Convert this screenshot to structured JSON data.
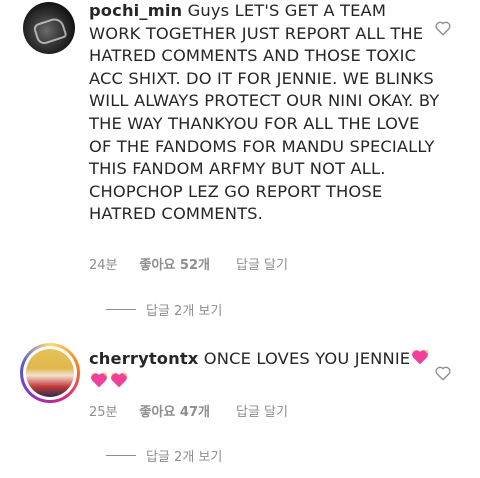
{
  "comments": [
    {
      "username": "pochi_min",
      "text": "Guys LET'S GET A TEAM WORK TOGETHER JUST REPORT ALL THE HATRED COMMENTS AND THOSE TOXIC ACC SHIXT. DO IT FOR JENNIE. WE BLINKS WILL ALWAYS PROTECT OUR NINI OKAY. BY THE WAY THANKYOU FOR ALL THE LOVE OF THE FANDOMS FOR MANDU SPECIALLY THIS FANDOM ARFMY BUT NOT ALL. CHOPCHOP LEZ GO REPORT THOSE HATRED COMMENTS.",
      "time": "24분",
      "likes": "좋아요 52개",
      "reply": "답글 달기",
      "view_replies": "답글 2개 보기",
      "heart_icon": "heart-outline-icon"
    },
    {
      "username": "cherrytontx",
      "text": "ONCE LOVES YOU JENNIE",
      "emoji": "💖💖💖",
      "emoji_icon": "sparkling-heart-emoji-icon",
      "time": "25분",
      "likes": "좋아요 47개",
      "reply": "답글 달기",
      "view_replies": "답글 2개 보기",
      "heart_icon": "heart-outline-icon"
    }
  ],
  "colors": {
    "text": "#262626",
    "muted": "#8e8e8e",
    "emoji_heart": "#f0409a"
  }
}
